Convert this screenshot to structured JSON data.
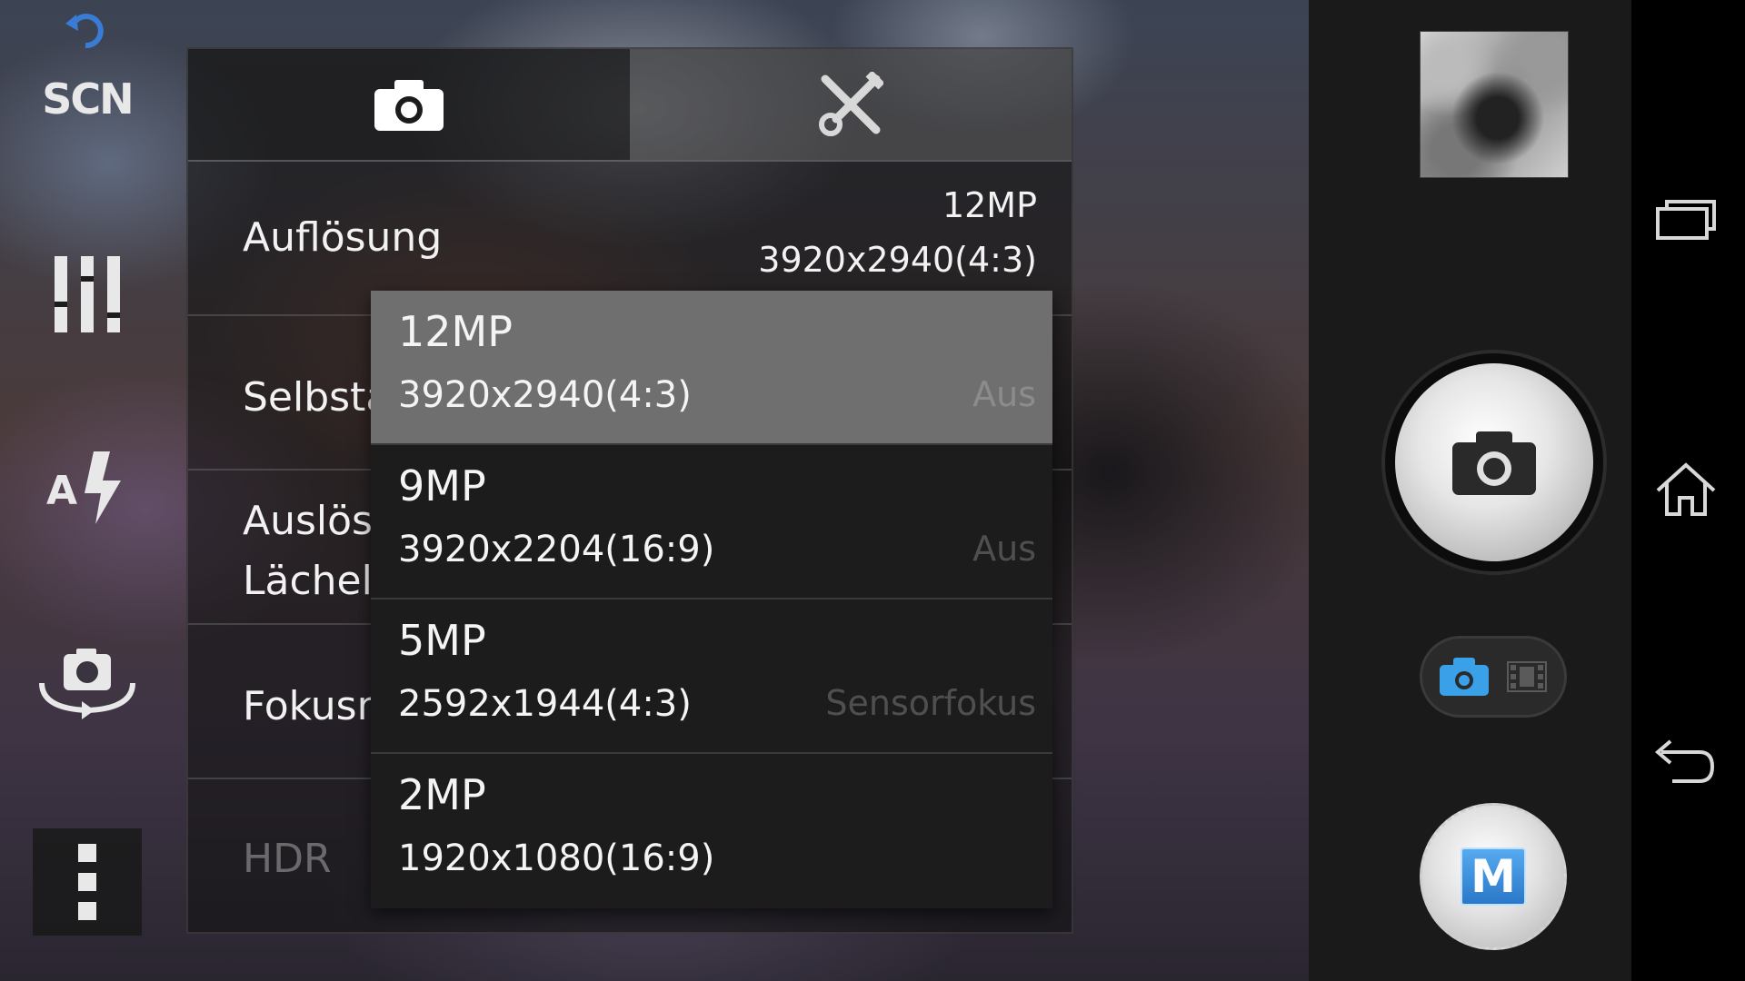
{
  "toolbar": {
    "scn_label": "SCN"
  },
  "tabs": [
    {
      "name": "camera-settings",
      "icon": "camera-icon"
    },
    {
      "name": "general-settings",
      "icon": "tools-icon"
    }
  ],
  "settings": {
    "resolution": {
      "label": "Auflösung",
      "value_mp": "12MP",
      "value_res": "3920x2940(4:3)"
    },
    "self_timer": {
      "label": "Selbsta",
      "value": "Aus"
    },
    "smile_shutter": {
      "label_line1": "Auslösung bei",
      "label_line2": "Lächeln",
      "value": "Aus"
    },
    "focus_mode": {
      "label": "Fokusm",
      "value": "Sensorfokus"
    },
    "hdr": {
      "label": "HDR",
      "enabled": false
    }
  },
  "resolution_dropdown": {
    "options": [
      {
        "mp": "12MP",
        "res": "3920x2940(4:3)",
        "selected": true
      },
      {
        "mp": "9MP",
        "res": "3920x2204(16:9)",
        "selected": false
      },
      {
        "mp": "5MP",
        "res": "2592x1944(4:3)",
        "selected": false
      },
      {
        "mp": "2MP",
        "res": "1920x1080(16:9)",
        "selected": false
      }
    ]
  },
  "controls": {
    "manual_label": "M"
  },
  "colors": {
    "accent": "#3aa0e8",
    "selected_option": "#6f6f6f"
  }
}
